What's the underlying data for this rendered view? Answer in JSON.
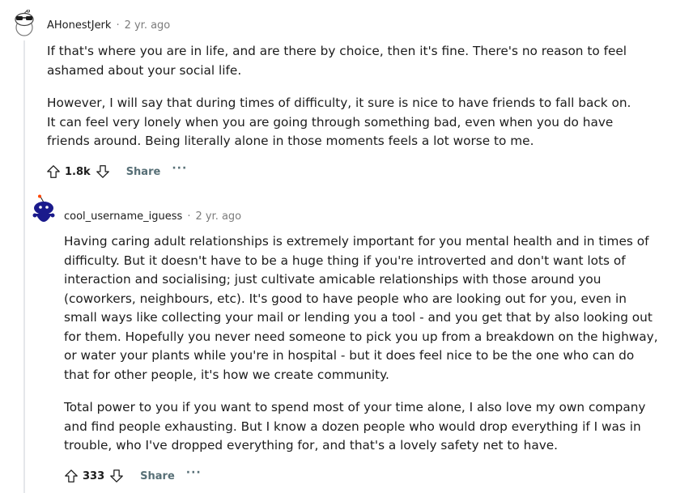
{
  "comments": [
    {
      "author": "AHonestJerk",
      "separator": "·",
      "time": "2 yr. ago",
      "paragraphs": [
        "If that's where you are in life, and are there by choice, then it's fine. There's no reason to feel ashamed about your social life.",
        "However, I will say that during times of difficulty, it sure is nice to have friends to fall back on. It can feel very lonely when you are going through something bad, even when you do have friends around. Being literally alone in those moments feels a lot worse to me."
      ],
      "score": "1.8k",
      "share_label": "Share",
      "more_label": "···"
    },
    {
      "author": "cool_username_iguess",
      "separator": "·",
      "time": "2 yr. ago",
      "paragraphs": [
        "Having caring adult relationships is extremely important for you mental health and in times of difficulty. But it doesn't have to be a huge thing if you're introverted and don't want lots of interaction and socialising; just cultivate amicable relationships with those around you (coworkers, neighbours, etc). It's good to have people who are looking out for you, even in small ways like collecting your mail or lending you a tool - and you get that by also looking out for them. Hopefully you never need someone to pick you up from a breakdown on the highway, or water your plants while you're in hospital - but it does feel nice to be the one who can do that for other people, it's how we create community.",
        "Total power to you if you want to spend most of your time alone, I also love my own company and find people exhausting. But I know a dozen people who would drop everything if I was in trouble, who I've dropped everything for, and that's a lovely safety net to have."
      ],
      "score": "333",
      "share_label": "Share",
      "more_label": "···"
    }
  ]
}
